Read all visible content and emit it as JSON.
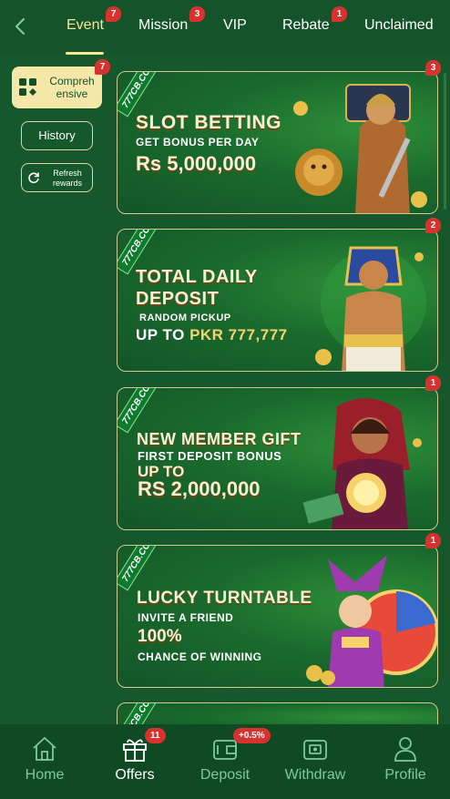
{
  "topbar": {
    "tabs": [
      {
        "label": "Event",
        "badge": "7",
        "active": true
      },
      {
        "label": "Mission",
        "badge": "3"
      },
      {
        "label": "VIP",
        "badge": ""
      },
      {
        "label": "Rebate",
        "badge": "1"
      },
      {
        "label": "Unclaimed",
        "badge": ""
      }
    ]
  },
  "sidebar": {
    "comprehensive": {
      "label": "Compreh ensive",
      "badge": "7"
    },
    "history_label": "History",
    "refresh_label": "Refresh rewards"
  },
  "cards": [
    {
      "badge": "3",
      "logo": "777CB.COM",
      "line1": "SLOT BETTING",
      "line2": "GET BONUS PER DAY",
      "line3": "Rs 5,000,000"
    },
    {
      "badge": "2",
      "logo": "777CB.COM",
      "line1": "TOTAL DAILY",
      "line1b": "DEPOSIT",
      "line2": "RANDOM PICKUP",
      "line3a": "UP TO ",
      "line3b": "PKR 777,777"
    },
    {
      "badge": "1",
      "logo": "777CB.COM",
      "line1": "NEW MEMBER GIFT",
      "line2": "FIRST DEPOSIT BONUS",
      "line3": "UP TO",
      "line4": "RS 2,000,000"
    },
    {
      "badge": "1",
      "logo": "777CB.COM",
      "line1": "LUCKY TURNTABLE",
      "line2": "INVITE A FRIEND",
      "line3": "100%",
      "line4": "CHANCE OF WINNING"
    }
  ],
  "bottomnav": {
    "items": [
      {
        "label": "Home",
        "icon": "home-icon"
      },
      {
        "label": "Offers",
        "icon": "gift-icon",
        "badge": "11",
        "active": true
      },
      {
        "label": "Deposit",
        "icon": "wallet-icon",
        "badge": "+0.5%"
      },
      {
        "label": "Withdraw",
        "icon": "ticket-icon"
      },
      {
        "label": "Profile",
        "icon": "user-icon"
      }
    ]
  },
  "colors": {
    "background": "#16582c",
    "accent": "#f7e69a",
    "badge": "#d8322f",
    "nav_inactive": "#7ec8a0"
  }
}
